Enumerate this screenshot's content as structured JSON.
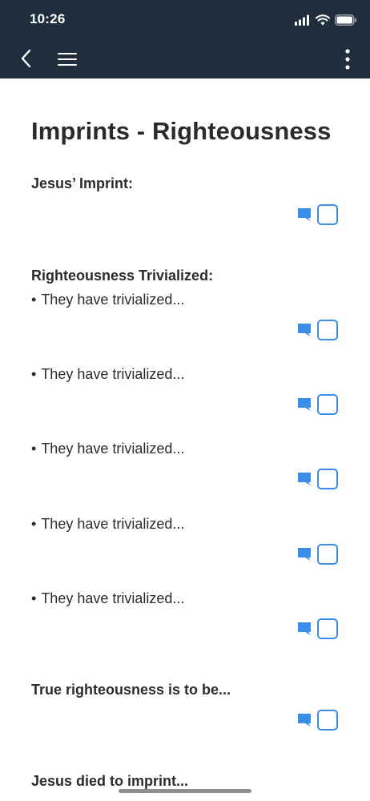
{
  "status_bar": {
    "time": "10:26",
    "icons": [
      "signal-icon",
      "wifi-icon",
      "battery-icon"
    ]
  },
  "nav": {
    "back_icon": "chevron-left-icon",
    "menu_icon": "hamburger-menu-icon",
    "more_icon": "more-vertical-icon"
  },
  "page": {
    "title": "Imprints - Righteousness"
  },
  "sections": {
    "jesus_imprint": {
      "heading": "Jesus’ Imprint:"
    },
    "trivialized": {
      "heading": "Righteousness Trivialized:",
      "bullet": "•",
      "items": [
        "They have trivialized...",
        "They have trivialized...",
        "They have trivialized...",
        "They have trivialized...",
        "They have trivialized..."
      ]
    },
    "true_righteousness": {
      "heading": "True righteousness is to be..."
    },
    "jesus_died": {
      "heading": "Jesus died to imprint..."
    }
  },
  "colors": {
    "header_bg": "#1f2d3d",
    "accent": "#3a8ee6",
    "text": "#2b2b2b"
  }
}
